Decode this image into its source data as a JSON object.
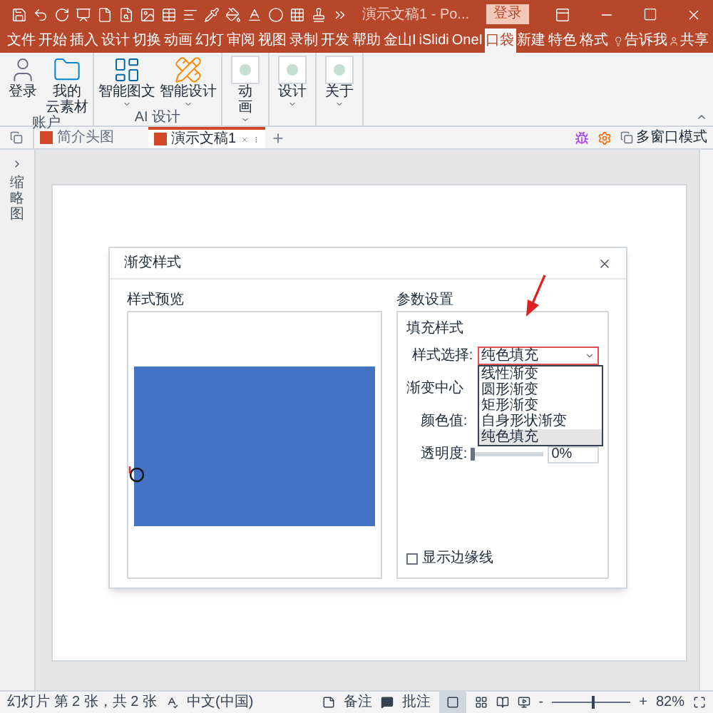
{
  "window": {
    "title": "演示文稿1 - Po...",
    "login_button": "登录"
  },
  "ribbon_tabs": [
    {
      "label": "文件",
      "selected": false
    },
    {
      "label": "开始",
      "selected": false
    },
    {
      "label": "插入",
      "selected": false
    },
    {
      "label": "设计",
      "selected": false
    },
    {
      "label": "切换",
      "selected": false
    },
    {
      "label": "动画",
      "selected": false
    },
    {
      "label": "幻灯",
      "selected": false
    },
    {
      "label": "审阅",
      "selected": false
    },
    {
      "label": "视图",
      "selected": false
    },
    {
      "label": "录制",
      "selected": false
    },
    {
      "label": "开发",
      "selected": false
    },
    {
      "label": "帮助",
      "selected": false
    },
    {
      "label": "金山I",
      "selected": false
    },
    {
      "label": "iSlidi",
      "selected": false
    },
    {
      "label": "OneI",
      "selected": false
    },
    {
      "label": "口袋",
      "selected": true
    },
    {
      "label": "新建",
      "selected": false
    },
    {
      "label": "特色",
      "selected": false
    },
    {
      "label": "格式",
      "selected": false
    }
  ],
  "tell_me": "告诉我",
  "share": "共享",
  "ribbon_groups": [
    {
      "label": "账户",
      "buttons": [
        {
          "kind": "user",
          "lines": [
            "登录"
          ],
          "dropdown": false
        },
        {
          "kind": "folder",
          "lines": [
            "我的",
            "云素材"
          ],
          "dropdown": false
        }
      ]
    },
    {
      "label": "AI 设计",
      "buttons": [
        {
          "kind": "board",
          "lines": [
            "智能图文"
          ],
          "dropdown": true
        },
        {
          "kind": "pencil",
          "lines": [
            "智能设计"
          ],
          "dropdown": true
        }
      ]
    },
    {
      "buttons": [
        {
          "kind": "placeholder",
          "lines": [
            "动",
            "画"
          ],
          "dropdown": true
        }
      ]
    },
    {
      "buttons": [
        {
          "kind": "placeholder",
          "lines": [
            "设计"
          ],
          "dropdown": true
        }
      ]
    },
    {
      "buttons": [
        {
          "kind": "placeholder",
          "lines": [
            "关于"
          ],
          "dropdown": true
        }
      ]
    }
  ],
  "doc_tabs": [
    {
      "label": "简介头图",
      "selected": false
    },
    {
      "label": "演示文稿1",
      "selected": true
    }
  ],
  "multi_window": "多窗口模式",
  "thumbnail_pane": "缩略图",
  "dialog": {
    "title": "渐变样式",
    "preview_label": "样式预览",
    "params_label": "参数设置",
    "fill_group": "填充样式",
    "style_label": "样式选择:",
    "style_value": "纯色填充",
    "options": [
      {
        "label": "线性渐变",
        "selected": false
      },
      {
        "label": "圆形渐变",
        "selected": false
      },
      {
        "label": "矩形渐变",
        "selected": false
      },
      {
        "label": "自身形状渐变",
        "selected": false
      },
      {
        "label": "纯色填充",
        "selected": true
      }
    ],
    "center_label": "渐变中心",
    "color_label": "颜色值:",
    "opacity_label": "透明度:",
    "opacity": {
      "level": 0,
      "reading": "0%"
    },
    "edge_checkbox": {
      "label": "显示边缘线",
      "checked": false
    }
  },
  "status_bar": {
    "slide_info": "幻灯片 第 2 张，共 2 张",
    "language": "中文(中国)",
    "notes": "备注",
    "comments": "批注",
    "minus": "-",
    "plus": "+",
    "zoom": {
      "level": 0.5
    },
    "zoom_reading": "82%"
  }
}
